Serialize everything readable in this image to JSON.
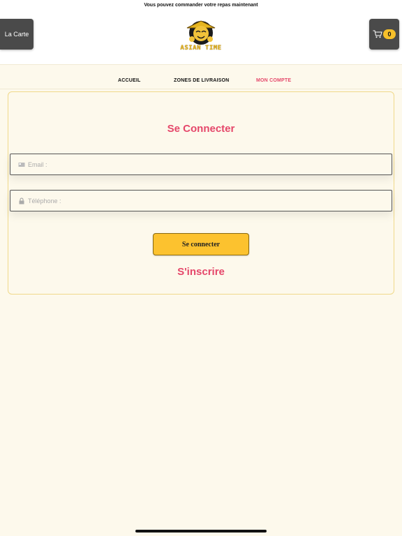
{
  "announcement": "Vous pouvez commander votre repas maintenant",
  "header": {
    "menu_button": "La Carte",
    "logo_text": "ASIAN TIME",
    "cart_count": "0"
  },
  "nav": {
    "items": [
      {
        "label": "ACCUEIL"
      },
      {
        "label": "ZONES DE LIVRAISON"
      },
      {
        "label": "MON COMPTE",
        "active": true
      }
    ]
  },
  "login": {
    "title": "Se Connecter",
    "email_placeholder": "Email :",
    "phone_placeholder": "Téléphone :",
    "submit_label": "Se connecter",
    "signup_label": "S'inscrire"
  },
  "colors": {
    "accent": "#e5476a",
    "button": "#fcc22f",
    "background": "#fdf9ec",
    "header_button": "#4a4a4a"
  }
}
